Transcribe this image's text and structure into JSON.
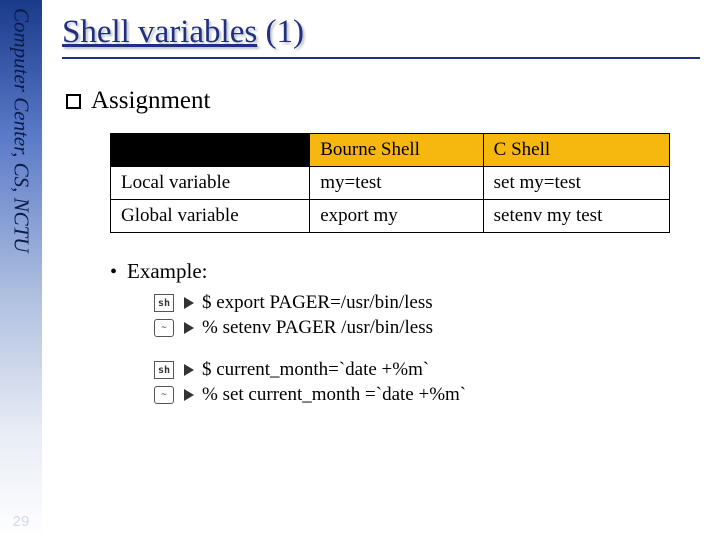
{
  "sidebar": {
    "org": "Computer Center, CS, NCTU",
    "page_number": "29"
  },
  "title": {
    "main": "Shell variables",
    "suffix": "(1)"
  },
  "section_heading": "Assignment",
  "table": {
    "col1_header": "Bourne Shell",
    "col2_header": "C Shell",
    "rows": [
      {
        "label": "Local variable",
        "bourne": "my=test",
        "csh": "set my=test"
      },
      {
        "label": "Global variable",
        "bourne": "export my",
        "csh": "setenv my test"
      }
    ]
  },
  "example_label": "Example:",
  "examples": {
    "group1": {
      "sh": "$ export PAGER=/usr/bin/less",
      "csh": "% setenv PAGER /usr/bin/less"
    },
    "group2": {
      "sh": "$ current_month=`date +%m`",
      "csh": "% set current_month =`date +%m`"
    }
  },
  "icons": {
    "sh_icon_text": "sh",
    "csh_icon_text": "~"
  }
}
